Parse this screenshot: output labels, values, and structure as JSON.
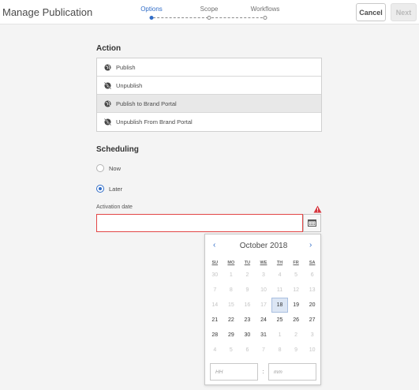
{
  "header": {
    "title": "Manage Publication",
    "steps": [
      {
        "label": "Options",
        "active": true
      },
      {
        "label": "Scope",
        "active": false
      },
      {
        "label": "Workflows",
        "active": false
      }
    ],
    "cancel_label": "Cancel",
    "next_label": "Next"
  },
  "action": {
    "title": "Action",
    "items": [
      {
        "label": "Publish",
        "icon": "globe-icon",
        "selected": false
      },
      {
        "label": "Unpublish",
        "icon": "globe-off-icon",
        "selected": false
      },
      {
        "label": "Publish to Brand Portal",
        "icon": "globe-icon",
        "selected": true
      },
      {
        "label": "Unpublish From Brand Portal",
        "icon": "globe-off-icon",
        "selected": false
      }
    ]
  },
  "scheduling": {
    "title": "Scheduling",
    "options": [
      {
        "label": "Now",
        "checked": false
      },
      {
        "label": "Later",
        "checked": true
      }
    ],
    "activation_label": "Activation date",
    "activation_value": ""
  },
  "calendar": {
    "month_label": "October 2018",
    "prev_symbol": "‹",
    "next_symbol": "›",
    "weekdays": [
      "SU",
      "MO",
      "TU",
      "WE",
      "TH",
      "FR",
      "SA"
    ],
    "weeks": [
      [
        "30",
        "1",
        "2",
        "3",
        "4",
        "5",
        "6"
      ],
      [
        "7",
        "8",
        "9",
        "10",
        "11",
        "12",
        "13"
      ],
      [
        "14",
        "15",
        "16",
        "17",
        "18",
        "19",
        "20"
      ],
      [
        "21",
        "22",
        "23",
        "24",
        "25",
        "26",
        "27"
      ],
      [
        "28",
        "29",
        "30",
        "31",
        "1",
        "2",
        "3"
      ],
      [
        "4",
        "5",
        "6",
        "7",
        "8",
        "9",
        "10"
      ]
    ],
    "muted": [
      [
        true,
        true,
        true,
        true,
        true,
        true,
        true
      ],
      [
        true,
        true,
        true,
        true,
        true,
        true,
        true
      ],
      [
        true,
        true,
        true,
        true,
        false,
        false,
        false
      ],
      [
        false,
        false,
        false,
        false,
        false,
        false,
        false
      ],
      [
        false,
        false,
        false,
        false,
        true,
        true,
        true
      ],
      [
        true,
        true,
        true,
        true,
        true,
        true,
        true
      ]
    ],
    "today": "18",
    "hour_placeholder": "HH",
    "minute_placeholder": "mm",
    "time_separator": ":"
  },
  "colors": {
    "accent": "#326ec8",
    "error": "#e24646"
  }
}
